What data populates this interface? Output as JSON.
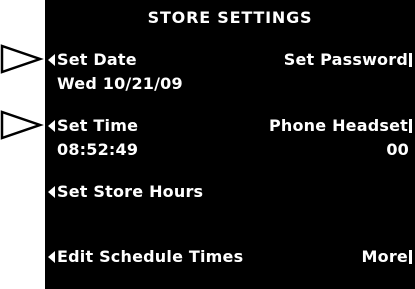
{
  "screen": {
    "title": "STORE SETTINGS",
    "background": "#000000",
    "foreground": "#ffffff"
  },
  "menu": {
    "set_date": {
      "label": "Set Date",
      "value": "Wed 10/21/09"
    },
    "set_time": {
      "label": "Set Time",
      "value": "08:52:49"
    },
    "set_store_hours": {
      "label": "Set Store Hours"
    },
    "edit_schedule_times": {
      "label": "Edit Schedule Times"
    },
    "set_password": {
      "label": "Set Password"
    },
    "phone_headset": {
      "label": "Phone Headset",
      "value": "00"
    },
    "more": {
      "label": "More"
    }
  },
  "icons": {
    "left_selector": "left-triangle-icon",
    "right_selector": "right-bar-icon",
    "callout_pointer": "outline-triangle-pointer-icon"
  }
}
